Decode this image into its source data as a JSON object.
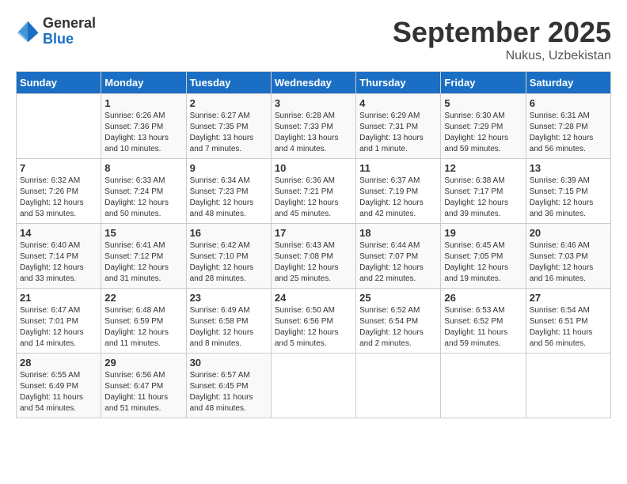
{
  "header": {
    "logo_general": "General",
    "logo_blue": "Blue",
    "month": "September 2025",
    "location": "Nukus, Uzbekistan"
  },
  "weekdays": [
    "Sunday",
    "Monday",
    "Tuesday",
    "Wednesday",
    "Thursday",
    "Friday",
    "Saturday"
  ],
  "weeks": [
    [
      {
        "day": "",
        "sunrise": "",
        "sunset": "",
        "daylight": ""
      },
      {
        "day": "1",
        "sunrise": "6:26 AM",
        "sunset": "7:36 PM",
        "daylight": "13 hours and 10 minutes."
      },
      {
        "day": "2",
        "sunrise": "6:27 AM",
        "sunset": "7:35 PM",
        "daylight": "13 hours and 7 minutes."
      },
      {
        "day": "3",
        "sunrise": "6:28 AM",
        "sunset": "7:33 PM",
        "daylight": "13 hours and 4 minutes."
      },
      {
        "day": "4",
        "sunrise": "6:29 AM",
        "sunset": "7:31 PM",
        "daylight": "13 hours and 1 minute."
      },
      {
        "day": "5",
        "sunrise": "6:30 AM",
        "sunset": "7:29 PM",
        "daylight": "12 hours and 59 minutes."
      },
      {
        "day": "6",
        "sunrise": "6:31 AM",
        "sunset": "7:28 PM",
        "daylight": "12 hours and 56 minutes."
      }
    ],
    [
      {
        "day": "7",
        "sunrise": "6:32 AM",
        "sunset": "7:26 PM",
        "daylight": "12 hours and 53 minutes."
      },
      {
        "day": "8",
        "sunrise": "6:33 AM",
        "sunset": "7:24 PM",
        "daylight": "12 hours and 50 minutes."
      },
      {
        "day": "9",
        "sunrise": "6:34 AM",
        "sunset": "7:23 PM",
        "daylight": "12 hours and 48 minutes."
      },
      {
        "day": "10",
        "sunrise": "6:36 AM",
        "sunset": "7:21 PM",
        "daylight": "12 hours and 45 minutes."
      },
      {
        "day": "11",
        "sunrise": "6:37 AM",
        "sunset": "7:19 PM",
        "daylight": "12 hours and 42 minutes."
      },
      {
        "day": "12",
        "sunrise": "6:38 AM",
        "sunset": "7:17 PM",
        "daylight": "12 hours and 39 minutes."
      },
      {
        "day": "13",
        "sunrise": "6:39 AM",
        "sunset": "7:15 PM",
        "daylight": "12 hours and 36 minutes."
      }
    ],
    [
      {
        "day": "14",
        "sunrise": "6:40 AM",
        "sunset": "7:14 PM",
        "daylight": "12 hours and 33 minutes."
      },
      {
        "day": "15",
        "sunrise": "6:41 AM",
        "sunset": "7:12 PM",
        "daylight": "12 hours and 31 minutes."
      },
      {
        "day": "16",
        "sunrise": "6:42 AM",
        "sunset": "7:10 PM",
        "daylight": "12 hours and 28 minutes."
      },
      {
        "day": "17",
        "sunrise": "6:43 AM",
        "sunset": "7:08 PM",
        "daylight": "12 hours and 25 minutes."
      },
      {
        "day": "18",
        "sunrise": "6:44 AM",
        "sunset": "7:07 PM",
        "daylight": "12 hours and 22 minutes."
      },
      {
        "day": "19",
        "sunrise": "6:45 AM",
        "sunset": "7:05 PM",
        "daylight": "12 hours and 19 minutes."
      },
      {
        "day": "20",
        "sunrise": "6:46 AM",
        "sunset": "7:03 PM",
        "daylight": "12 hours and 16 minutes."
      }
    ],
    [
      {
        "day": "21",
        "sunrise": "6:47 AM",
        "sunset": "7:01 PM",
        "daylight": "12 hours and 14 minutes."
      },
      {
        "day": "22",
        "sunrise": "6:48 AM",
        "sunset": "6:59 PM",
        "daylight": "12 hours and 11 minutes."
      },
      {
        "day": "23",
        "sunrise": "6:49 AM",
        "sunset": "6:58 PM",
        "daylight": "12 hours and 8 minutes."
      },
      {
        "day": "24",
        "sunrise": "6:50 AM",
        "sunset": "6:56 PM",
        "daylight": "12 hours and 5 minutes."
      },
      {
        "day": "25",
        "sunrise": "6:52 AM",
        "sunset": "6:54 PM",
        "daylight": "12 hours and 2 minutes."
      },
      {
        "day": "26",
        "sunrise": "6:53 AM",
        "sunset": "6:52 PM",
        "daylight": "11 hours and 59 minutes."
      },
      {
        "day": "27",
        "sunrise": "6:54 AM",
        "sunset": "6:51 PM",
        "daylight": "11 hours and 56 minutes."
      }
    ],
    [
      {
        "day": "28",
        "sunrise": "6:55 AM",
        "sunset": "6:49 PM",
        "daylight": "11 hours and 54 minutes."
      },
      {
        "day": "29",
        "sunrise": "6:56 AM",
        "sunset": "6:47 PM",
        "daylight": "11 hours and 51 minutes."
      },
      {
        "day": "30",
        "sunrise": "6:57 AM",
        "sunset": "6:45 PM",
        "daylight": "11 hours and 48 minutes."
      },
      {
        "day": "",
        "sunrise": "",
        "sunset": "",
        "daylight": ""
      },
      {
        "day": "",
        "sunrise": "",
        "sunset": "",
        "daylight": ""
      },
      {
        "day": "",
        "sunrise": "",
        "sunset": "",
        "daylight": ""
      },
      {
        "day": "",
        "sunrise": "",
        "sunset": "",
        "daylight": ""
      }
    ]
  ]
}
